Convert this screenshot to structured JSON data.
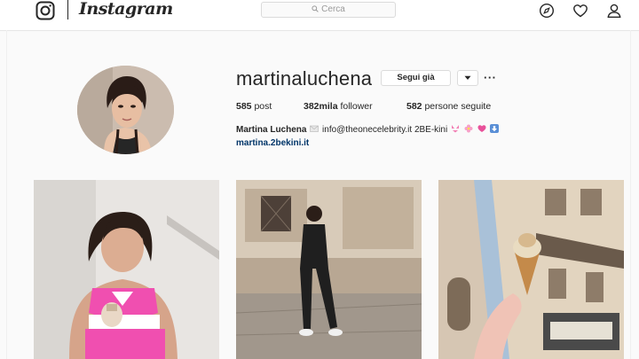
{
  "header": {
    "brand": "Instagram",
    "search_placeholder": "Cerca"
  },
  "profile": {
    "username": "martinaluchena",
    "follow_label": "Segui già",
    "more_label": "···",
    "stats": {
      "posts_value": "585",
      "posts_label": "post",
      "followers_value": "382mila",
      "followers_label": "follower",
      "following_value": "582",
      "following_label": "persone seguite"
    },
    "bio_name": "Martina Luchena",
    "bio_text": "info@theonecelebrity.it 2BE-kini",
    "bio_link": "martina.2bekini.it"
  },
  "icons": {
    "logo": "instagram-camera-icon",
    "search": "search-icon",
    "explore": "compass-icon",
    "activity": "heart-icon",
    "profile": "person-icon",
    "dropdown": "chevron-down-icon",
    "bio_emojis": [
      "envelope-emoji",
      "bikini-emoji",
      "flower-emoji",
      "heart-emoji",
      "down-arrow-emoji"
    ]
  },
  "colors": {
    "background": "#fafafa",
    "text": "#262626",
    "link": "#003569",
    "border": "#dbdbdb",
    "post_1_accent": "#f04fb0"
  },
  "posts": [
    {
      "label": ""
    },
    {
      "label": ""
    },
    {
      "label": ""
    }
  ]
}
